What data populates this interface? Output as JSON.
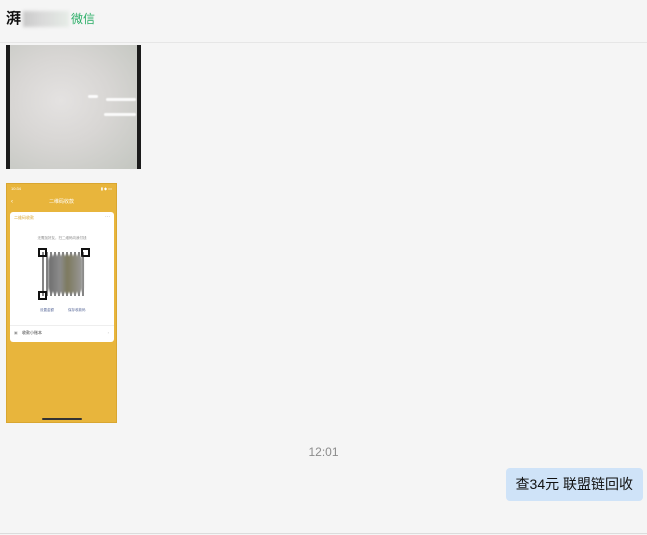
{
  "header": {
    "title_initial": "湃",
    "title_suffix": "微信"
  },
  "messages": {
    "screenshot": {
      "status_time": "10:34",
      "status_right": "▮ ◆ ▭",
      "nav_title": "二维码收款",
      "card_title": "二维码收款",
      "card_tip": "无需加好友，扫二维码向我付钱",
      "action_set_amount": "设置金额",
      "action_save_qr": "保存收款码",
      "footer_label": "收款小账本"
    },
    "timestamp": "12:01",
    "sent_text": "查34元  联盟链回收"
  },
  "colors": {
    "background": "#f5f5f5",
    "accent_green": "#2aae67",
    "bubble_sent": "#cfe3f8",
    "screenshot_yellow": "#e8b53c"
  }
}
